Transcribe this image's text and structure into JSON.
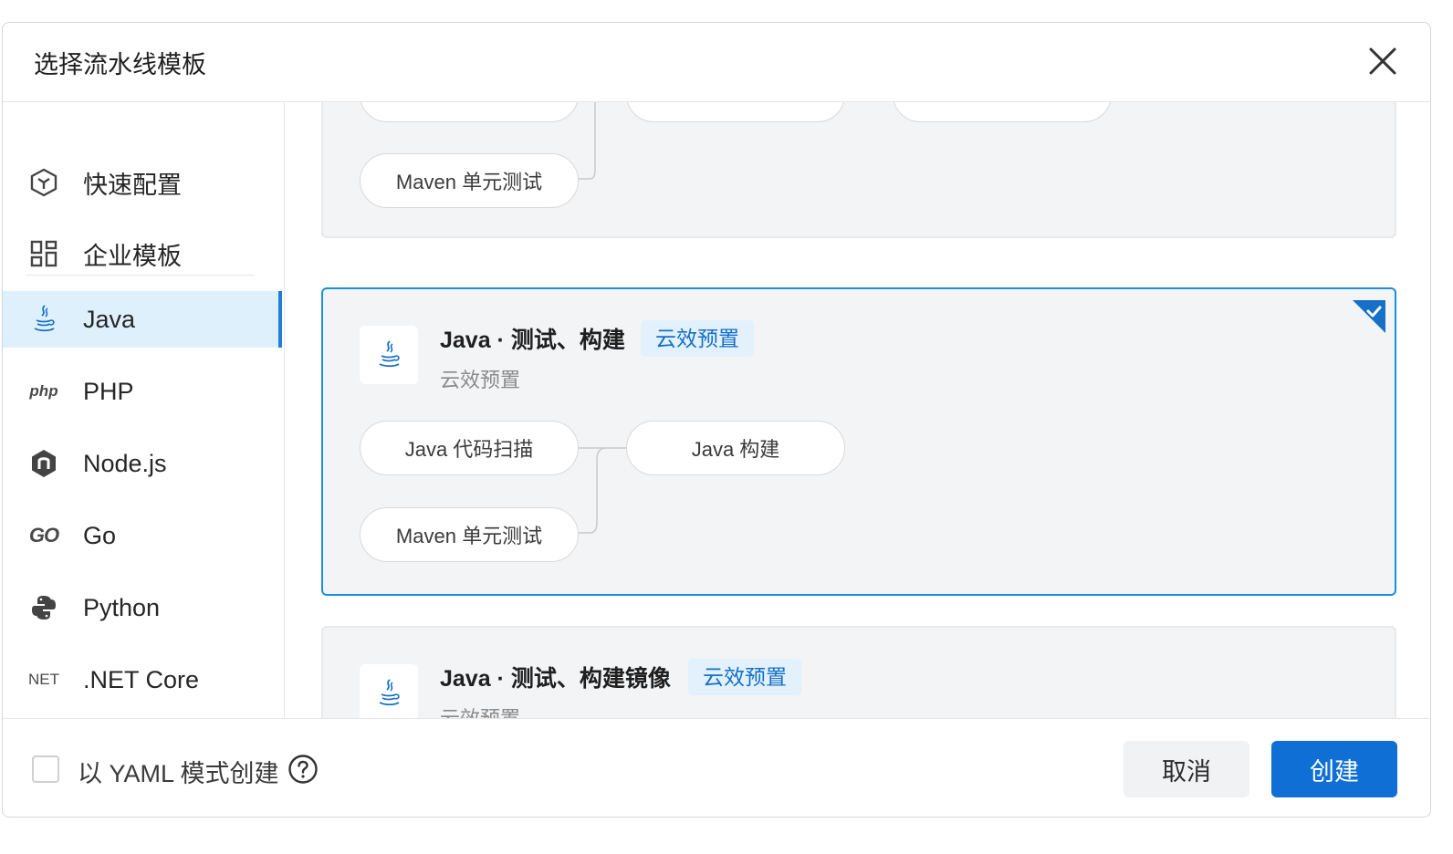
{
  "dialog": {
    "title": "选择流水线模板",
    "close_icon": "close-icon"
  },
  "sidebar": {
    "items": [
      {
        "label": "快速配置",
        "icon": "cube-icon"
      },
      {
        "label": "企业模板",
        "icon": "grid-icon"
      },
      {
        "label": "Java",
        "icon": "java-icon",
        "active": true
      },
      {
        "label": "PHP",
        "icon": "php-icon",
        "logo_text": "php"
      },
      {
        "label": "Node.js",
        "icon": "nodejs-icon"
      },
      {
        "label": "Go",
        "icon": "go-icon",
        "logo_text": "GO"
      },
      {
        "label": "Python",
        "icon": "python-icon"
      },
      {
        "label": ".NET Core",
        "icon": "dotnet-icon",
        "logo_text": "NET"
      }
    ]
  },
  "templates": [
    {
      "partial": true,
      "steps": [
        "Maven 单元测试"
      ]
    },
    {
      "name": "Java · 测试、构建",
      "badge": "云效预置",
      "sub": "云效预置",
      "selected": true,
      "steps": [
        "Java 代码扫描",
        "Java 构建",
        "Maven 单元测试"
      ]
    },
    {
      "name": "Java · 测试、构建镜像",
      "badge": "云效预置",
      "sub": "云效预置"
    }
  ],
  "footer": {
    "yaml_label": "以 YAML 模式创建",
    "cancel_label": "取消",
    "create_label": "创建"
  },
  "colors": {
    "accent": "#0f6fd4",
    "selected_border": "#1b8ee0",
    "active_nav_bg": "#dff0fd",
    "badge_bg": "#e3f1fd"
  }
}
